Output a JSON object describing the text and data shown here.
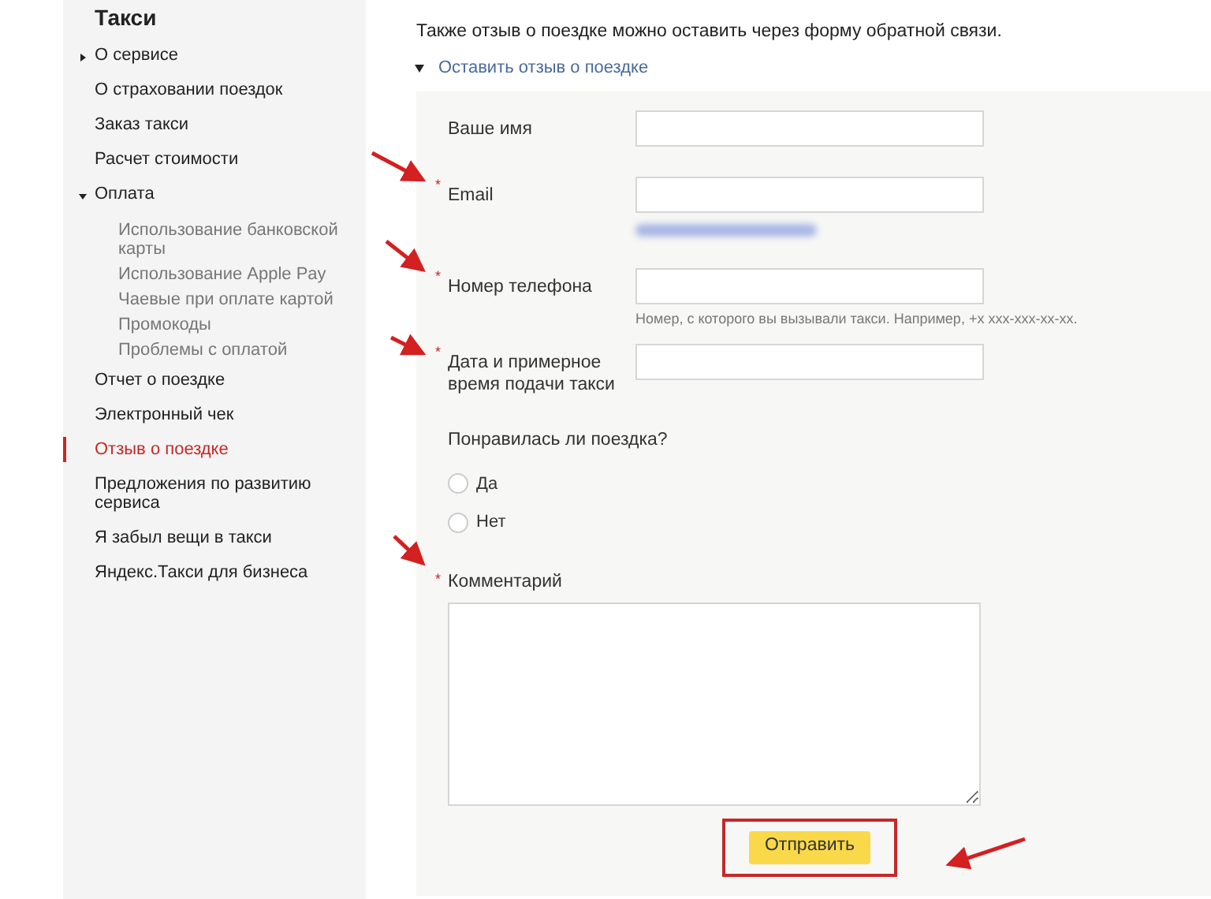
{
  "sidebar": {
    "title": "Такси",
    "items": [
      {
        "label": "О сервисе",
        "selected": false,
        "expanded": false
      },
      {
        "label": "О страховании поездок",
        "selected": false
      },
      {
        "label": "Заказ такси",
        "selected": false
      },
      {
        "label": "Расчет стоимости",
        "selected": false
      },
      {
        "label": "Оплата",
        "selected": false,
        "expanded": true,
        "children": [
          {
            "label": "Использование банковской карты",
            "selected": false
          },
          {
            "label": "Использование Apple Pay",
            "selected": false
          },
          {
            "label": "Чаевые при оплате картой",
            "selected": false
          },
          {
            "label": "Промокоды",
            "selected": false
          },
          {
            "label": "Проблемы с оплатой",
            "selected": false
          }
        ]
      },
      {
        "label": "Отчет о поездке",
        "selected": false
      },
      {
        "label": "Электронный чек",
        "selected": false
      },
      {
        "label": "Отзыв о поездке",
        "selected": true
      },
      {
        "label": "Предложения по развитию сервиса",
        "selected": false
      },
      {
        "label": "Я забыл вещи в такси",
        "selected": false
      },
      {
        "label": "Яндекс.Такси для бизнеса",
        "selected": false
      }
    ]
  },
  "content": {
    "intro": "Также отзыв о поездке можно оставить через форму обратной связи.",
    "toggle": {
      "label": "Оставить отзыв о поездке",
      "expanded": true
    },
    "form": {
      "required_mark": "*",
      "fields": [
        {
          "kind": "input",
          "label": "Ваше имя",
          "required": false
        },
        {
          "kind": "input",
          "label": "Email",
          "required": true,
          "redacted_hint": true
        },
        {
          "kind": "input",
          "label": "Номер телефона",
          "required": true,
          "hint": "Номер, с которого вы вызывали такси. Например, +x xxx-xxx-xx-xx."
        },
        {
          "kind": "input",
          "label": "Дата и примерное время подачи такси",
          "required": true
        }
      ],
      "question": "Понравилась ли поездка?",
      "options": [
        {
          "label": "Да",
          "selected": false
        },
        {
          "label": "Нет",
          "selected": false
        }
      ],
      "comment": {
        "label": "Комментарий",
        "required": true
      },
      "submit": "Отправить"
    }
  }
}
